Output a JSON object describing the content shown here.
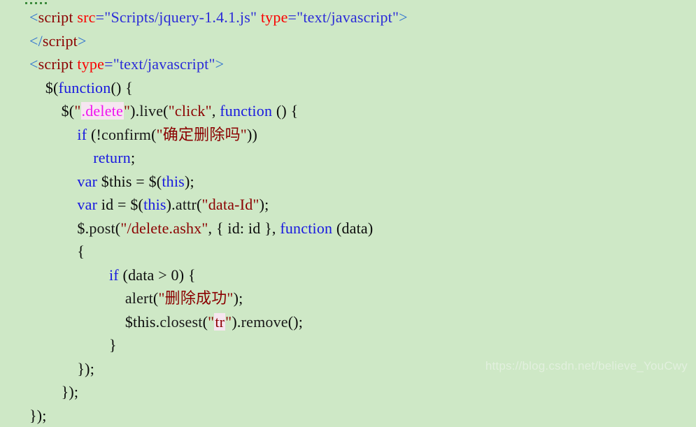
{
  "editor": {
    "background_color": "#cee8c6",
    "marker": "collapsed-region-dots",
    "language": "html-javascript",
    "lines": [
      {
        "id": "line-1",
        "indent": 0,
        "tokens": [
          {
            "kind": "bracket",
            "text": "<"
          },
          {
            "kind": "tag",
            "text": "script"
          },
          {
            "kind": "plain",
            "text": " "
          },
          {
            "kind": "attr",
            "text": "src"
          },
          {
            "kind": "eq",
            "text": "="
          },
          {
            "kind": "str",
            "text": "\"Scripts/jquery-1.4.1.js\""
          },
          {
            "kind": "plain",
            "text": " "
          },
          {
            "kind": "attr",
            "text": "type"
          },
          {
            "kind": "eq",
            "text": "="
          },
          {
            "kind": "str",
            "text": "\"text/javascript\""
          },
          {
            "kind": "bracket",
            "text": ">"
          }
        ]
      },
      {
        "id": "line-2",
        "indent": 0,
        "tokens": [
          {
            "kind": "bracket",
            "text": "</"
          },
          {
            "kind": "tag",
            "text": "script"
          },
          {
            "kind": "bracket",
            "text": ">"
          }
        ]
      },
      {
        "id": "line-3",
        "indent": 0,
        "tokens": [
          {
            "kind": "bracket",
            "text": "<"
          },
          {
            "kind": "tag",
            "text": "script"
          },
          {
            "kind": "plain",
            "text": " "
          },
          {
            "kind": "attr",
            "text": "type"
          },
          {
            "kind": "eq",
            "text": "="
          },
          {
            "kind": "str",
            "text": "\"text/javascript\""
          },
          {
            "kind": "bracket",
            "text": ">"
          }
        ]
      },
      {
        "id": "line-4",
        "indent": 4,
        "tokens": [
          {
            "kind": "punct",
            "text": "$("
          },
          {
            "kind": "kw",
            "text": "function"
          },
          {
            "kind": "punct",
            "text": "() {"
          }
        ]
      },
      {
        "id": "line-5",
        "indent": 8,
        "tokens": [
          {
            "kind": "punct",
            "text": "$("
          },
          {
            "kind": "jsstr",
            "text": "\""
          },
          {
            "kind": "sel",
            "text": ".delete",
            "highlight": true
          },
          {
            "kind": "jsstr",
            "text": "\""
          },
          {
            "kind": "punct",
            "text": ")."
          },
          {
            "kind": "plain",
            "text": "live"
          },
          {
            "kind": "punct",
            "text": "("
          },
          {
            "kind": "jsstr",
            "text": "\"click\""
          },
          {
            "kind": "punct",
            "text": ", "
          },
          {
            "kind": "kw",
            "text": "function"
          },
          {
            "kind": "punct",
            "text": " () {"
          }
        ]
      },
      {
        "id": "line-6",
        "indent": 12,
        "tokens": [
          {
            "kind": "kw",
            "text": "if"
          },
          {
            "kind": "punct",
            "text": " (!"
          },
          {
            "kind": "plain",
            "text": "confirm"
          },
          {
            "kind": "punct",
            "text": "("
          },
          {
            "kind": "jsstr",
            "text": "\"确定删除吗\""
          },
          {
            "kind": "punct",
            "text": "))"
          }
        ]
      },
      {
        "id": "line-7",
        "indent": 16,
        "tokens": [
          {
            "kind": "kw",
            "text": "return"
          },
          {
            "kind": "punct",
            "text": ";"
          }
        ]
      },
      {
        "id": "line-8",
        "indent": 12,
        "tokens": [
          {
            "kind": "kw",
            "text": "var"
          },
          {
            "kind": "punct",
            "text": " $this = $("
          },
          {
            "kind": "kw",
            "text": "this"
          },
          {
            "kind": "punct",
            "text": ");"
          }
        ]
      },
      {
        "id": "line-9",
        "indent": 12,
        "tokens": [
          {
            "kind": "kw",
            "text": "var"
          },
          {
            "kind": "punct",
            "text": " id = $("
          },
          {
            "kind": "kw",
            "text": "this"
          },
          {
            "kind": "punct",
            "text": ")."
          },
          {
            "kind": "plain",
            "text": "attr"
          },
          {
            "kind": "punct",
            "text": "("
          },
          {
            "kind": "jsstr",
            "text": "\"data-Id\""
          },
          {
            "kind": "punct",
            "text": ");"
          }
        ]
      },
      {
        "id": "line-10",
        "indent": 12,
        "tokens": [
          {
            "kind": "punct",
            "text": "$."
          },
          {
            "kind": "plain",
            "text": "post"
          },
          {
            "kind": "punct",
            "text": "("
          },
          {
            "kind": "jsstr",
            "text": "\"/delete.ashx\""
          },
          {
            "kind": "punct",
            "text": ", { id: id }, "
          },
          {
            "kind": "kw",
            "text": "function"
          },
          {
            "kind": "punct",
            "text": " (data)"
          }
        ]
      },
      {
        "id": "line-11",
        "indent": 12,
        "tokens": [
          {
            "kind": "punct",
            "text": "{"
          }
        ]
      },
      {
        "id": "line-12",
        "indent": 20,
        "tokens": [
          {
            "kind": "kw",
            "text": "if"
          },
          {
            "kind": "punct",
            "text": " (data > 0) {"
          }
        ]
      },
      {
        "id": "line-13",
        "indent": 24,
        "tokens": [
          {
            "kind": "plain",
            "text": "alert"
          },
          {
            "kind": "punct",
            "text": "("
          },
          {
            "kind": "jsstr",
            "text": "\"删除成功\""
          },
          {
            "kind": "punct",
            "text": ");"
          }
        ]
      },
      {
        "id": "line-14",
        "indent": 24,
        "tokens": [
          {
            "kind": "punct",
            "text": "$this."
          },
          {
            "kind": "plain",
            "text": "closest"
          },
          {
            "kind": "punct",
            "text": "("
          },
          {
            "kind": "jsstr",
            "text": "\""
          },
          {
            "kind": "jsstr",
            "text": "tr",
            "highlight": true
          },
          {
            "kind": "jsstr",
            "text": "\""
          },
          {
            "kind": "punct",
            "text": ")."
          },
          {
            "kind": "plain",
            "text": "remove"
          },
          {
            "kind": "punct",
            "text": "();"
          }
        ]
      },
      {
        "id": "line-15",
        "indent": 20,
        "tokens": [
          {
            "kind": "punct",
            "text": "}"
          }
        ]
      },
      {
        "id": "line-16",
        "indent": 12,
        "tokens": [
          {
            "kind": "punct",
            "text": "});"
          }
        ]
      },
      {
        "id": "line-17",
        "indent": 8,
        "tokens": [
          {
            "kind": "punct",
            "text": "});"
          }
        ]
      },
      {
        "id": "line-18",
        "indent": 0,
        "tokens": [
          {
            "kind": "punct",
            "text": "});"
          }
        ]
      }
    ]
  },
  "watermark": {
    "text": "https://blog.csdn.net/believe_YouCwy"
  }
}
